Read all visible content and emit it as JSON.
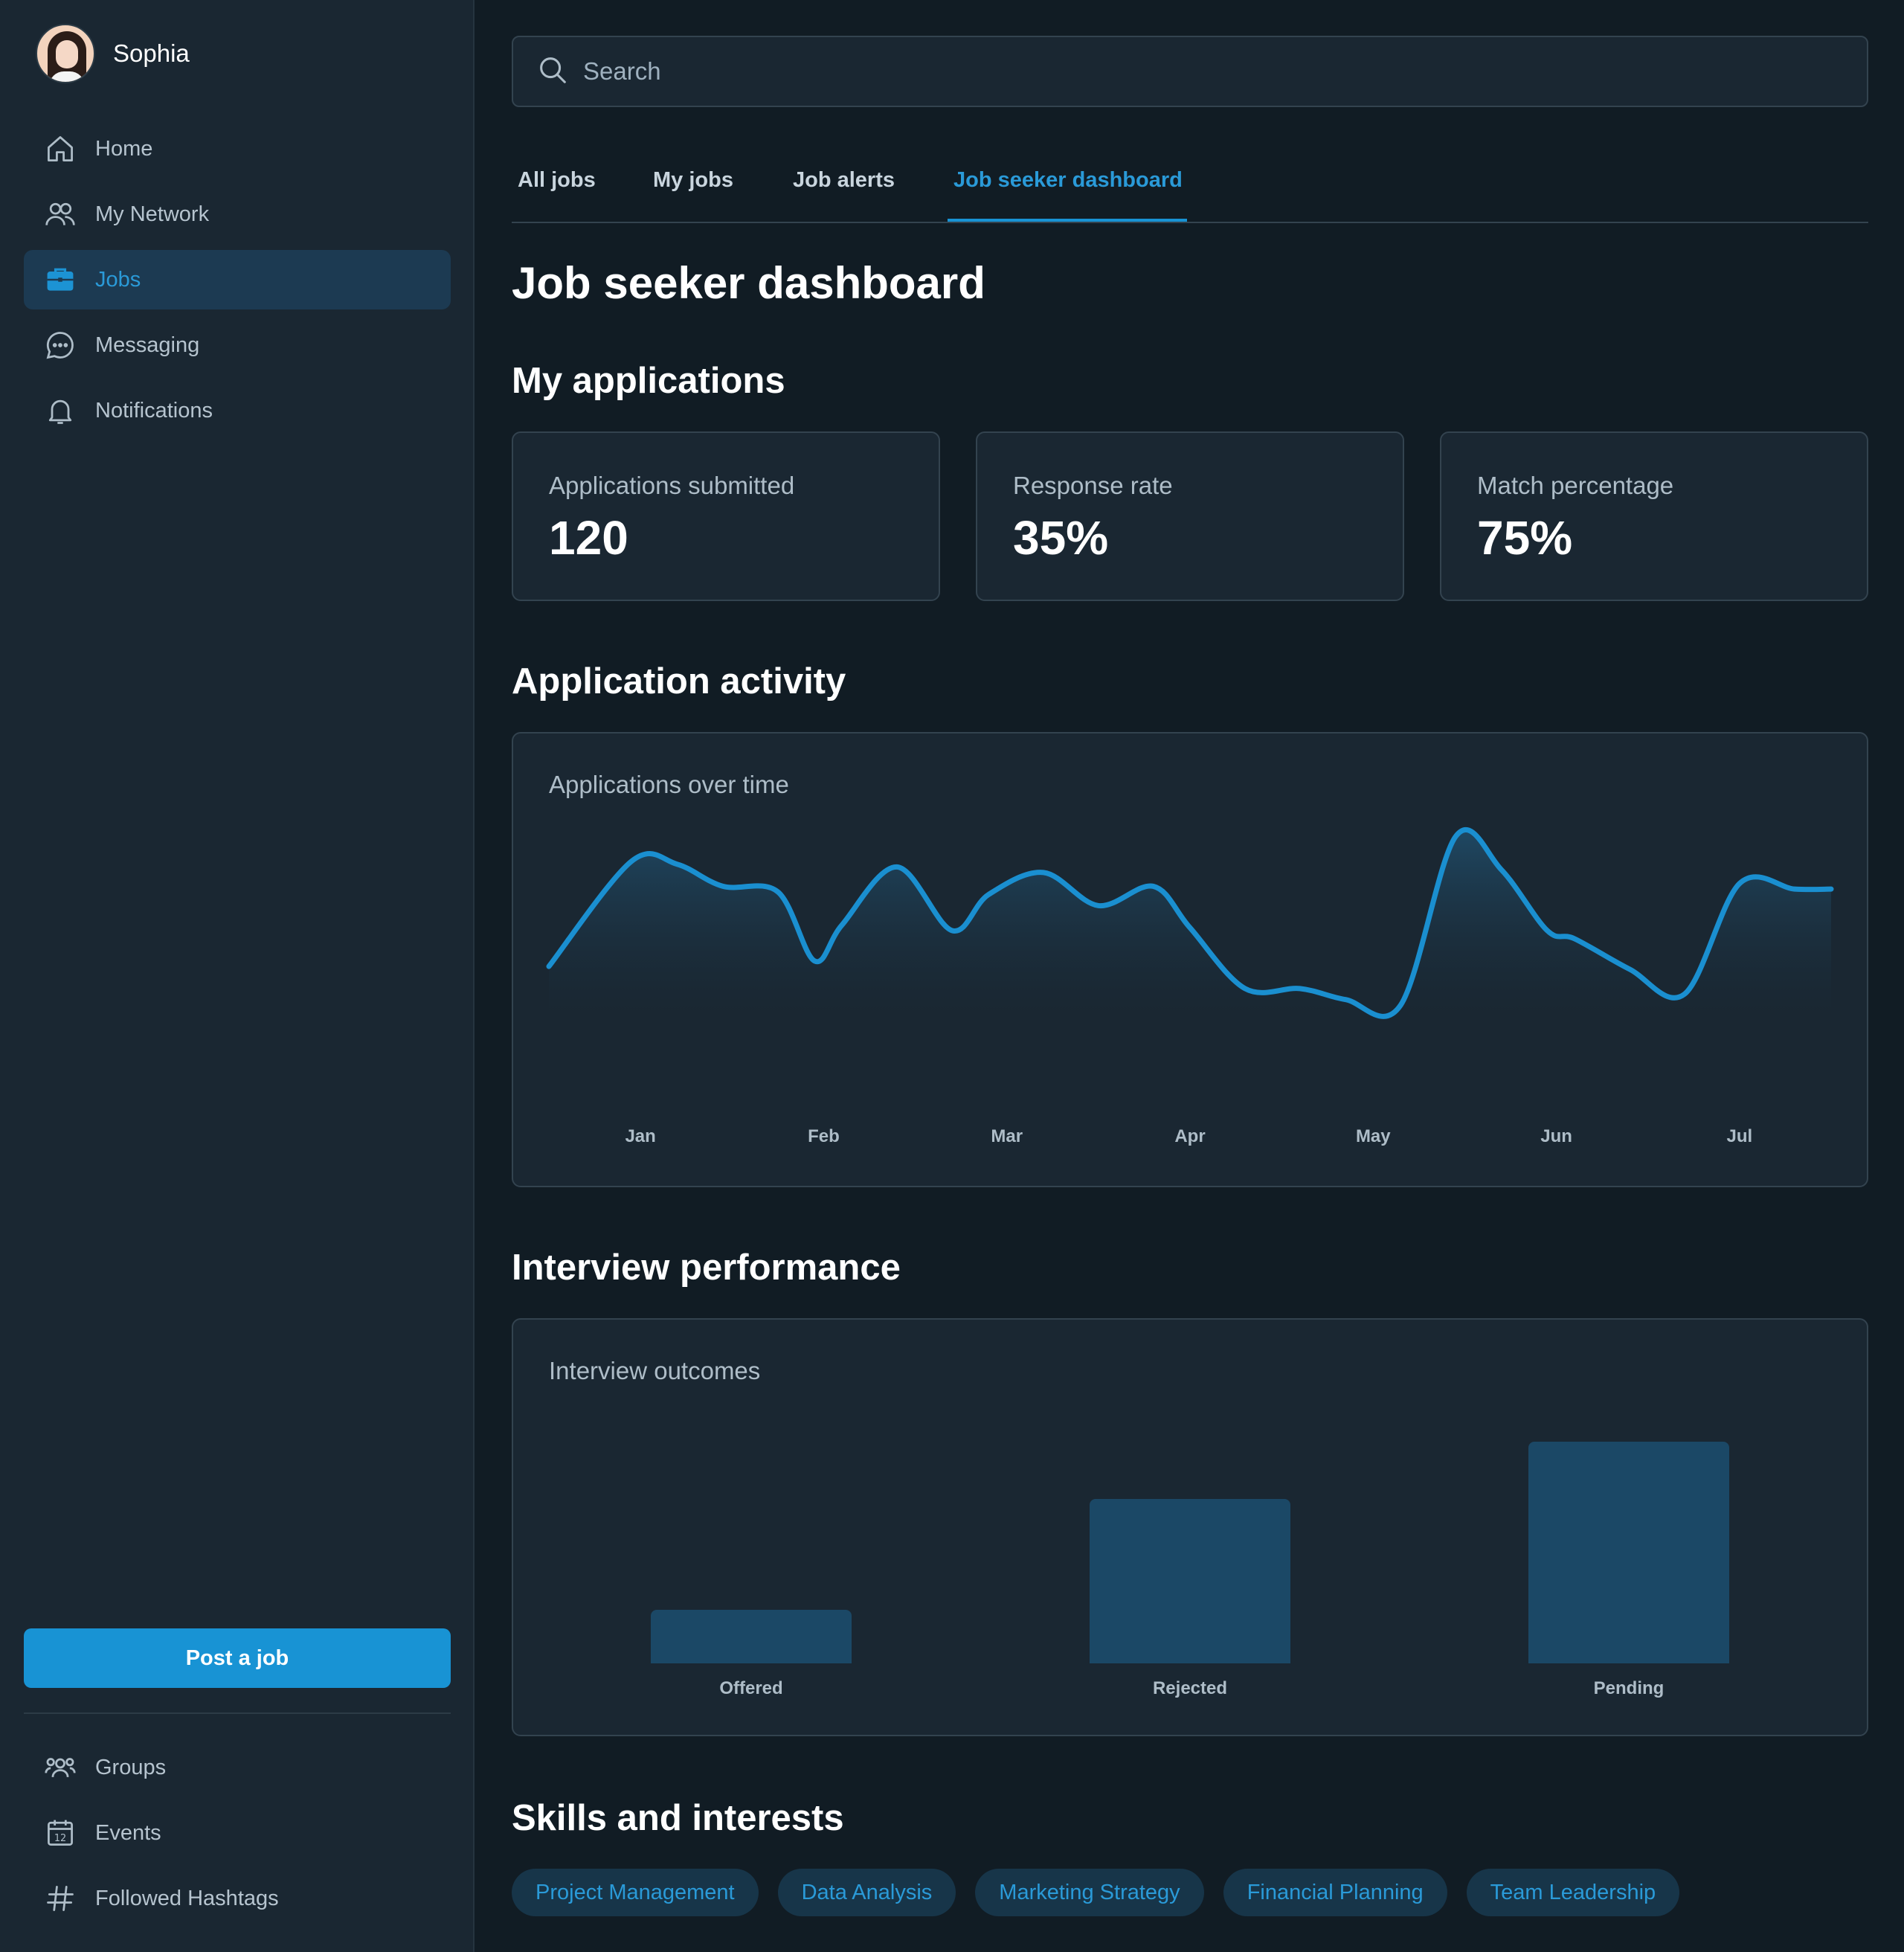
{
  "user": {
    "name": "Sophia"
  },
  "sidebar": {
    "items": [
      {
        "label": "Home",
        "icon": "home-icon"
      },
      {
        "label": "My Network",
        "icon": "network-icon"
      },
      {
        "label": "Jobs",
        "icon": "briefcase-icon"
      },
      {
        "label": "Messaging",
        "icon": "message-icon"
      },
      {
        "label": "Notifications",
        "icon": "bell-icon"
      }
    ],
    "active_item": "Jobs",
    "post_job_label": "Post a job",
    "secondary_items": [
      {
        "label": "Groups",
        "icon": "groups-icon"
      },
      {
        "label": "Events",
        "icon": "calendar-icon"
      },
      {
        "label": "Followed Hashtags",
        "icon": "hashtag-icon"
      }
    ]
  },
  "search": {
    "placeholder": "Search"
  },
  "tabs": [
    {
      "label": "All jobs"
    },
    {
      "label": "My jobs"
    },
    {
      "label": "Job alerts"
    },
    {
      "label": "Job seeker dashboard"
    }
  ],
  "active_tab": "Job seeker dashboard",
  "page": {
    "title": "Job seeker dashboard"
  },
  "applications": {
    "section_title": "My applications",
    "stats": [
      {
        "label": "Applications submitted",
        "value": "120"
      },
      {
        "label": "Response rate",
        "value": "35%"
      },
      {
        "label": "Match percentage",
        "value": "75%"
      }
    ]
  },
  "activity": {
    "section_title": "Application activity",
    "chart_title": "Applications over time"
  },
  "interviews": {
    "section_title": "Interview performance",
    "chart_title": "Interview outcomes"
  },
  "skills": {
    "section_title": "Skills and interests",
    "chips": [
      "Project Management",
      "Data Analysis",
      "Marketing Strategy",
      "Financial Planning",
      "Team Leadership"
    ]
  },
  "colors": {
    "accent": "#1893d4",
    "line": "#1a8fd0",
    "bar": "#1b4866",
    "background": "#111c24",
    "panel": "#1a2732"
  },
  "chart_data": [
    {
      "type": "area",
      "title": "Applications over time",
      "categories": [
        "Jan",
        "Feb",
        "Mar",
        "Apr",
        "May",
        "Jun",
        "Jul"
      ],
      "x": [
        -0.5,
        -0.05,
        0.2,
        0.45,
        0.75,
        0.95,
        1.1,
        1.4,
        1.7,
        1.9,
        2.2,
        2.5,
        2.8,
        3.0,
        3.3,
        3.6,
        3.85,
        4.15,
        4.45,
        4.7,
        4.95,
        5.1,
        5.4,
        5.7,
        6.0,
        6.3,
        6.5
      ],
      "values": [
        18,
        56,
        55,
        47,
        45,
        20,
        33,
        54,
        31,
        44,
        52,
        40,
        47,
        32,
        10,
        10,
        6,
        4,
        65,
        53,
        31,
        28,
        17,
        8,
        48,
        46,
        46
      ],
      "ylim": [
        0,
        70
      ],
      "grid": false,
      "legend": "none"
    },
    {
      "type": "bar",
      "title": "Interview outcomes",
      "categories": [
        "Offered",
        "Rejected",
        "Pending"
      ],
      "values": [
        14,
        43,
        58
      ],
      "ylim": [
        0,
        70
      ],
      "grid": false,
      "legend": "none"
    }
  ]
}
